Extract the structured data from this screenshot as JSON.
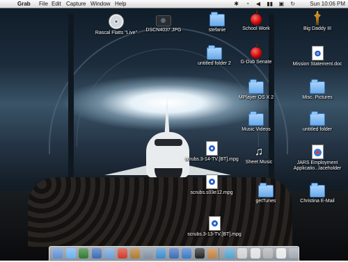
{
  "menubar": {
    "apple": "",
    "app_name": "Grab",
    "menus": [
      "File",
      "Edit",
      "Capture",
      "Window",
      "Help"
    ],
    "clock": "Sun 10:06 PM"
  },
  "desktop_icons": [
    {
      "label": "Rascal Flatts \"Live\"",
      "icon": "cd-icon"
    },
    {
      "label": "DSCN4037.JPG",
      "icon": "camera-icon"
    },
    {
      "label": "stefanie",
      "icon": "folder-icon"
    },
    {
      "label": "School Work",
      "icon": "apple-icon"
    },
    {
      "label": "Big Daddy III",
      "icon": "figure-icon"
    },
    {
      "label": "untitled folder 2",
      "icon": "folder-icon"
    },
    {
      "label": "G-Dub Senate",
      "icon": "apple-icon"
    },
    {
      "label": "Mission Statement.doc",
      "icon": "doc-icon"
    },
    {
      "label": "MPlayer OS X 2",
      "icon": "folder-icon"
    },
    {
      "label": "Misc. Pictures",
      "icon": "folder-icon"
    },
    {
      "label": "Music Videos",
      "icon": "folder-icon"
    },
    {
      "label": "untitled folder",
      "icon": "folder-icon"
    },
    {
      "label": "scrubs.3-14-TV.[BT].mpg",
      "icon": "mpeg-icon"
    },
    {
      "label": "Sheet Music",
      "icon": "music-icon"
    },
    {
      "label": "JARS Employment Applicatio...laceholder",
      "icon": "web-doc-icon"
    },
    {
      "label": "scrubs.s03e12.mpg",
      "icon": "mpeg-icon"
    },
    {
      "label": "getTunes",
      "icon": "folder-icon"
    },
    {
      "label": "Christina E-Mail",
      "icon": "folder-icon"
    },
    {
      "label": "scrubs.3-13-TV.[BT].mpg",
      "icon": "mpeg-icon"
    }
  ],
  "dock": {
    "apps": [
      "finder",
      "mail",
      "ichat",
      "itunes",
      "safari",
      "ical",
      "address-book",
      "system-preferences",
      "app-store",
      "itunes-music",
      "quicktime",
      "terminal",
      "photo",
      "app",
      "preview",
      "app2",
      "app3",
      "app4",
      "folder-docs"
    ],
    "colors": [
      "#5a8fd6",
      "#6ab0f0",
      "#2e7a2e",
      "#3a6ab8",
      "#6a9fd8",
      "#d03a2a",
      "#b07830",
      "#8090a0",
      "#3a8ad0",
      "#3a6ab8",
      "#3a78c8",
      "#222222",
      "#c08040",
      "#50a0d0",
      "#d0d0d0",
      "#e0e0e0",
      "#b0b0b0",
      "#e8e8e8",
      "#a0a8b0"
    ]
  }
}
